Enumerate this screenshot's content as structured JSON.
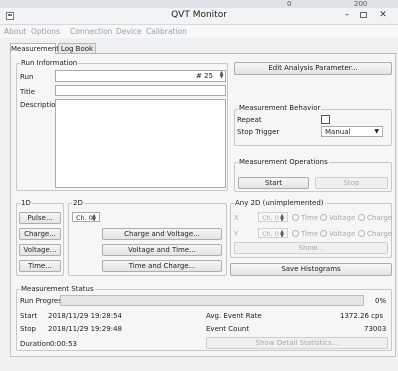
{
  "background_numbers": [
    "0",
    "200"
  ],
  "window": {
    "title": "QVT Monitor",
    "minimize": "–",
    "close": "✕"
  },
  "menu": [
    "About",
    "Options",
    "Connection",
    "Device",
    "Calibration"
  ],
  "tabs": [
    "Measurement",
    "Log Book"
  ],
  "run_info": {
    "group": "Run Information",
    "run_label": "Run",
    "run_value": "# 25",
    "title_label": "Title",
    "title_value": "",
    "description_label": "Description",
    "description_value": ""
  },
  "edit_analysis": "Edit Analysis Parameter...",
  "behavior": {
    "group": "Measurement Behavior",
    "repeat_label": "Repeat",
    "repeat_checked": false,
    "stop_trigger_label": "Stop Trigger",
    "stop_trigger_value": "Manual"
  },
  "operations": {
    "group": "Measurement Operations",
    "start": "Start",
    "stop": "Stop"
  },
  "one_d": {
    "group": "1D",
    "buttons": [
      "Pulse...",
      "Charge...",
      "Voltage...",
      "Time..."
    ]
  },
  "two_d": {
    "group": "2D",
    "channel": "Ch. 0",
    "buttons": [
      "Charge and Voltage...",
      "Voltage and Time...",
      "Time and Charge..."
    ]
  },
  "any2d": {
    "group": "Any 2D (unimplemented)",
    "x_label": "X",
    "y_label": "Y",
    "channel": "Ch. 0",
    "options": [
      "Time",
      "Voltage",
      "Charge"
    ],
    "show": "Show..."
  },
  "save_histograms": "Save Histograms",
  "status": {
    "group": "Measurement Status",
    "progress_label": "Run Progress",
    "progress_text": "0%",
    "progress_fraction": 0,
    "start_label": "Start",
    "start_value": "2018/11/29 19:28:54",
    "stop_label": "Stop",
    "stop_value": "2018/11/29 19:29:48",
    "duration_label": "Duration",
    "duration_value": "0:00:53",
    "avg_rate_label": "Avg. Event Rate",
    "avg_rate_value": "1372.26 cps",
    "event_count_label": "Event Count",
    "event_count_value": "73003",
    "detail_button": "Show Detail Statistics..."
  }
}
